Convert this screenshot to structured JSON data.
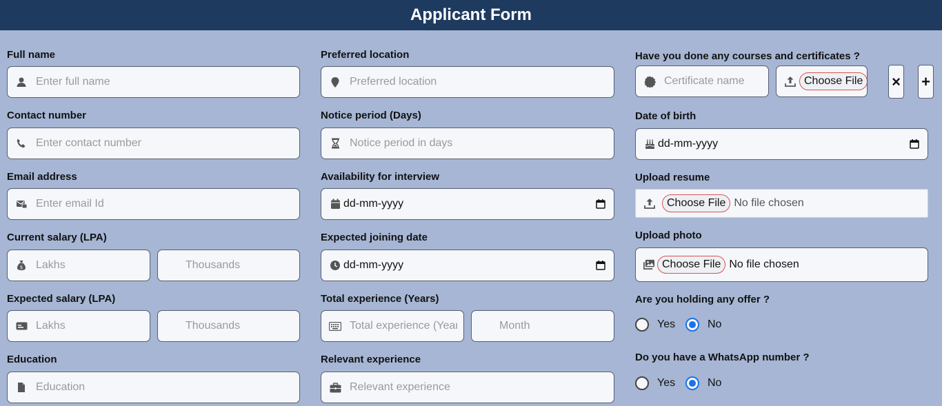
{
  "header": {
    "title": "Applicant Form"
  },
  "col1": {
    "full_name": {
      "label": "Full name",
      "placeholder": "Enter full name",
      "icon": "user-icon"
    },
    "contact": {
      "label": "Contact number",
      "placeholder": "Enter contact number",
      "icon": "phone-icon"
    },
    "email": {
      "label": "Email address",
      "placeholder": "Enter email Id",
      "icon": "mail-icon"
    },
    "current_salary": {
      "label": "Current salary (LPA)",
      "lakhs_placeholder": "Lakhs",
      "thousands_placeholder": "Thousands",
      "icon": "money-bag-icon"
    },
    "expected_salary": {
      "label": "Expected salary (LPA)",
      "lakhs_placeholder": "Lakhs",
      "thousands_placeholder": "Thousands",
      "icon": "money-card-icon"
    },
    "education": {
      "label": "Education",
      "placeholder": "Education",
      "icon": "document-icon"
    }
  },
  "col2": {
    "location": {
      "label": "Preferred location",
      "placeholder": "Preferred location",
      "icon": "location-pin-icon"
    },
    "notice": {
      "label": "Notice period (Days)",
      "placeholder": "Notice period in days",
      "icon": "hourglass-icon"
    },
    "availability": {
      "label": "Availability for interview",
      "value": "dd-mm-yyyy",
      "icon": "calendar-icon"
    },
    "joining": {
      "label": "Expected joining date",
      "value": "dd-mm-yyyy",
      "icon": "clock-icon"
    },
    "total_exp": {
      "label": "Total experience (Years)",
      "years_placeholder": "Total experience (Years)",
      "month_placeholder": "Month",
      "icon": "keyboard-icon"
    },
    "relevant_exp": {
      "label": "Relevant experience",
      "placeholder": "Relevant experience",
      "icon": "briefcase-icon"
    }
  },
  "col3": {
    "courses": {
      "label": "Have you done any courses and certificates ?",
      "placeholder": "Certificate name",
      "choose_label": "Choose File",
      "remove_label": "×",
      "add_label": "+",
      "icon": "certificate-icon",
      "upload_icon": "upload-icon"
    },
    "dob": {
      "label": "Date of birth",
      "value": "dd-mm-yyyy",
      "icon": "cake-icon"
    },
    "resume": {
      "label": "Upload resume",
      "choose_label": "Choose File",
      "status": "No file chosen",
      "icon": "upload-icon"
    },
    "photo": {
      "label": "Upload photo",
      "choose_label": "Choose File",
      "status": "No file chosen",
      "icon": "images-icon"
    },
    "offer": {
      "label": "Are you holding any offer ?",
      "yes": "Yes",
      "no": "No",
      "selected": "No"
    },
    "whatsapp": {
      "label": "Do you have a WhatsApp number ?",
      "yes": "Yes",
      "no": "No",
      "selected": "No"
    }
  },
  "colors": {
    "header_bg": "#1e3a5f",
    "page_bg": "#a6b6d4",
    "field_bg": "#f5f7fb",
    "radio_selected": "#1a73e8",
    "choose_border": "#d9534f"
  }
}
